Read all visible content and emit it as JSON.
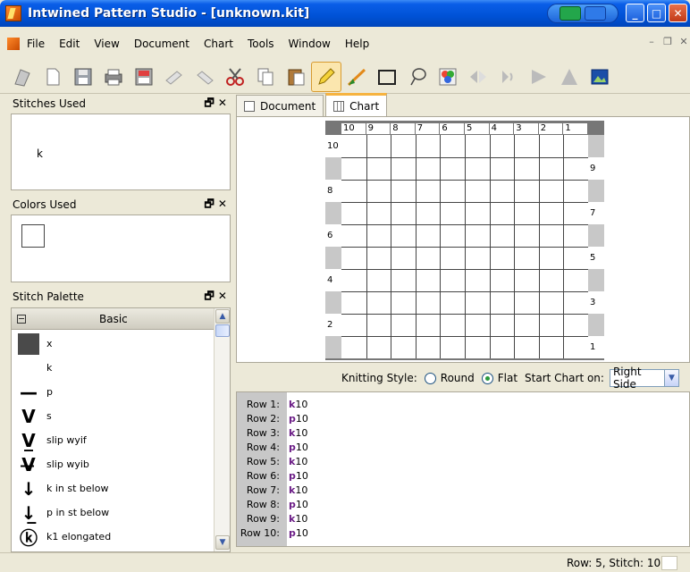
{
  "window": {
    "title": "Intwined Pattern Studio - [unknown.kit]"
  },
  "menu": [
    "File",
    "Edit",
    "View",
    "Document",
    "Chart",
    "Tools",
    "Window",
    "Help"
  ],
  "toolbar": [
    "open-icon",
    "new-document-icon",
    "save-icon",
    "print-icon",
    "pdf-icon",
    "undo-icon",
    "redo-icon",
    "cut-icon",
    "copy-icon",
    "paste-icon",
    "pencil-icon",
    "line-icon",
    "rectangle-icon",
    "lasso-icon",
    "color-picker-icon",
    "flip-icon",
    "rotate-icon",
    "arrow-right-icon",
    "triangle-icon",
    "image-icon"
  ],
  "panels": {
    "stitches_used": {
      "title": "Stitches Used",
      "items": [
        "k"
      ]
    },
    "colors_used": {
      "title": "Colors Used",
      "swatch": "#ffffff"
    },
    "stitch_palette": {
      "title": "Stitch Palette",
      "group": "Basic",
      "items": [
        {
          "symbol": "",
          "name": "x",
          "fill": "#4a4a4a"
        },
        {
          "symbol": "",
          "name": "k",
          "fill": ""
        },
        {
          "symbol": "—",
          "name": "p",
          "fill": ""
        },
        {
          "symbol": "V",
          "name": "s",
          "fill": ""
        },
        {
          "symbol": "V̲",
          "name": "slip wyif",
          "fill": ""
        },
        {
          "symbol": "V̶",
          "name": "slip wyib",
          "fill": ""
        },
        {
          "symbol": "↓",
          "name": "k in st below",
          "fill": ""
        },
        {
          "symbol": "↓̲",
          "name": "p in st below",
          "fill": ""
        },
        {
          "symbol": "ⓚ",
          "name": "k1 elongated",
          "fill": ""
        }
      ]
    },
    "close_glyph": "✕",
    "float_glyph": "🗗"
  },
  "tabs": [
    "Document",
    "Chart"
  ],
  "chart": {
    "columns": [
      "10",
      "9",
      "8",
      "7",
      "6",
      "5",
      "4",
      "3",
      "2",
      "1"
    ],
    "left_row_labels": [
      "10",
      "",
      "8",
      "",
      "6",
      "",
      "4",
      "",
      "2",
      ""
    ],
    "right_row_labels": [
      "",
      "9",
      "",
      "7",
      "",
      "5",
      "",
      "3",
      "",
      "1"
    ]
  },
  "knitting": {
    "label": "Knitting Style:",
    "round": "Round",
    "flat": "Flat",
    "start_label": "Start Chart on:",
    "start_value": "Right Side",
    "selected": "flat"
  },
  "rows": [
    {
      "label": "Row 1:",
      "stitch": "k",
      "count": "10"
    },
    {
      "label": "Row 2:",
      "stitch": "p",
      "count": "10"
    },
    {
      "label": "Row 3:",
      "stitch": "k",
      "count": "10"
    },
    {
      "label": "Row 4:",
      "stitch": "p",
      "count": "10"
    },
    {
      "label": "Row 5:",
      "stitch": "k",
      "count": "10"
    },
    {
      "label": "Row 6:",
      "stitch": "p",
      "count": "10"
    },
    {
      "label": "Row 7:",
      "stitch": "k",
      "count": "10"
    },
    {
      "label": "Row 8:",
      "stitch": "p",
      "count": "10"
    },
    {
      "label": "Row 9:",
      "stitch": "k",
      "count": "10"
    },
    {
      "label": "Row 10:",
      "stitch": "p",
      "count": "10"
    }
  ],
  "status": {
    "text": "Row: 5, Stitch: 10"
  }
}
